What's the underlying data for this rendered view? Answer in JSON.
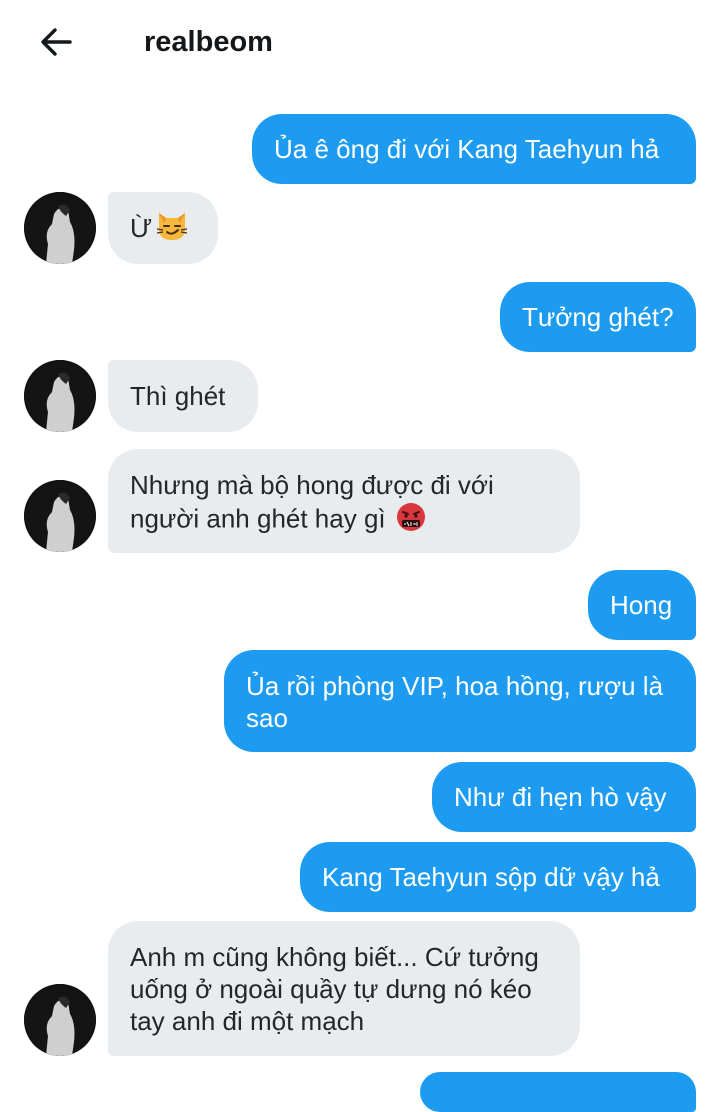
{
  "header": {
    "title": "realbeom"
  },
  "messages": [
    {
      "text": "Ủa ê ông đi với Kang Taehyun hả"
    },
    {
      "text": "Ừ",
      "emoji": "smirking-cat-icon"
    },
    {
      "text": "Tưởng ghét?"
    },
    {
      "text": "Thì ghét"
    },
    {
      "text": "Nhưng mà bộ hong được đi với người anh ghét hay gì",
      "emoji": "face-with-symbols-icon"
    },
    {
      "text": "Hong"
    },
    {
      "text": "Ủa rồi phòng VIP, hoa hồng, rượu là sao"
    },
    {
      "text": "Như đi hẹn hò vậy"
    },
    {
      "text": "Kang Taehyun sộp dữ vậy hả"
    },
    {
      "text": "Anh m cũng không biết... Cứ tưởng uống ở ngoài quầy tự dưng nó kéo tay anh đi một mạch"
    }
  ],
  "colors": {
    "outgoing": "#1d9bf0",
    "incoming": "#e9ecef",
    "text_dark": "#23272b"
  }
}
